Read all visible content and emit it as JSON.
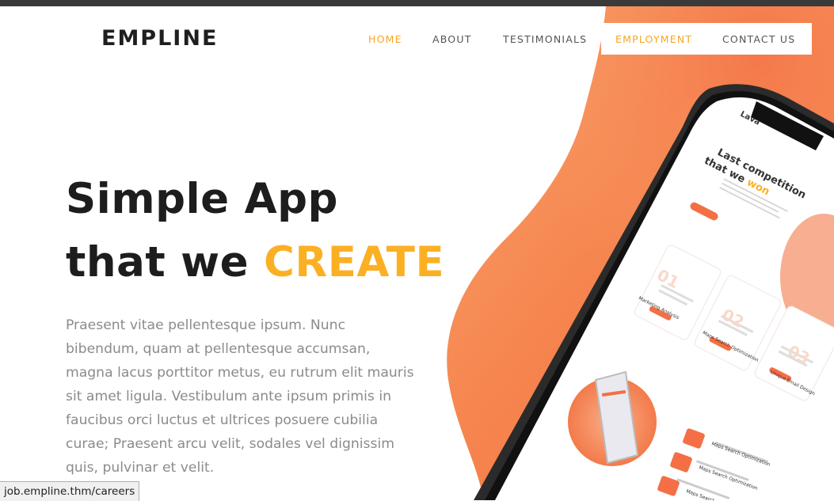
{
  "brand": {
    "name": "EMPLINE"
  },
  "nav": {
    "items": [
      {
        "label": "HOME",
        "active": true
      },
      {
        "label": "ABOUT",
        "active": false
      },
      {
        "label": "TESTIMONIALS",
        "active": false
      },
      {
        "label": "EMPLOYMENT",
        "active": true
      },
      {
        "label": "CONTACT US",
        "active": false
      }
    ]
  },
  "hero": {
    "title_line1": "Simple App",
    "title_line2_prefix": "that we ",
    "title_line2_accent": "CREATE",
    "paragraph": "Praesent vitae pellentesque ipsum. Nunc bibendum, quam at pellentesque accumsan, magna lacus porttitor metus, eu rutrum elit mauris sit amet ligula. Vestibulum ante ipsum primis in faucibus orci luctus et ultrices posuere cubilia curae; Praesent arcu velit, sodales vel dignissim quis, pulvinar et velit."
  },
  "phone_screen": {
    "top_label": "Lava",
    "headline_line1": "Last competition",
    "headline_line2_prefix": "that we ",
    "headline_line2_accent": "won",
    "cards": [
      {
        "number": "01",
        "title": "Marketing Analysis"
      },
      {
        "number": "02",
        "title": "Maps Search Optimization"
      },
      {
        "number": "03",
        "title": "Unique Email Design"
      }
    ],
    "list_items": [
      "Maps Search Optimization",
      "Maps Search Optimization",
      "Maps Search"
    ]
  },
  "status_bar": {
    "url": "job.empline.thm/careers"
  },
  "colors": {
    "accent": "#fbb024",
    "nav_active": "#f6a623",
    "orange": "#f36b3d",
    "text_dark": "#1d1d1d",
    "text_muted": "#8b8b8b"
  }
}
